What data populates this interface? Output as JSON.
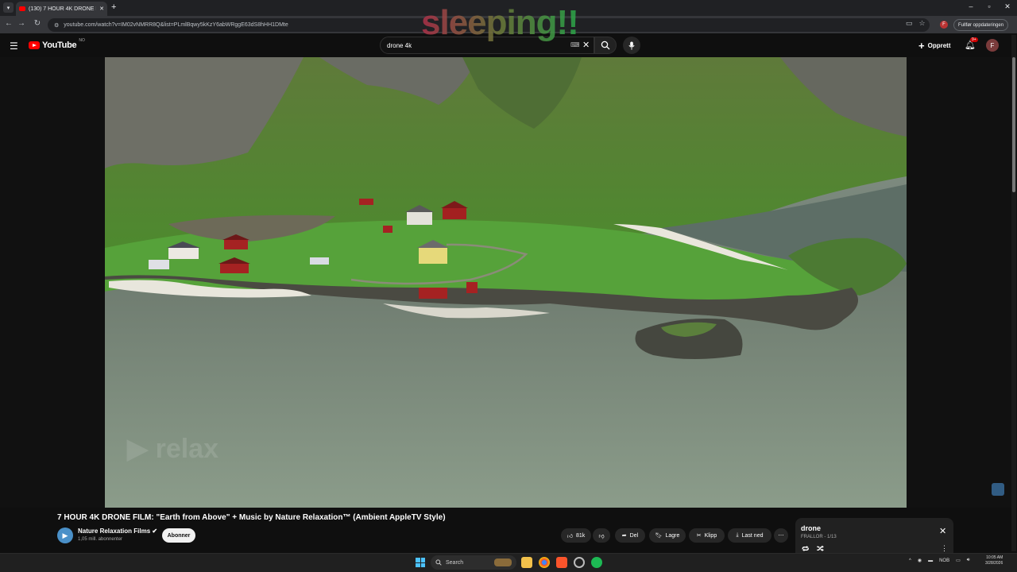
{
  "browser": {
    "tab_title": "(130) 7 HOUR 4K DRONE FILM...",
    "url": "youtube.com/watch?v=IM02vNMRR8Q&list=PLmlBqwy5kKzY6abWRggE63dS8hHH1DMte",
    "update_button": "Fullfør oppdateringen"
  },
  "overlay_text": "sleeping!!",
  "youtube": {
    "logo": "YouTube",
    "country_code": "NO",
    "search_value": "drone 4k",
    "create_label": "Opprett",
    "notification_count": "9+",
    "avatar_letter": "F"
  },
  "video": {
    "title": "7 HOUR 4K DRONE FILM: \"Earth from Above\" + Music by Nature Relaxation™ (Ambient AppleTV Style)",
    "channel": "Nature Relaxation Films ✔",
    "subscribers": "1,05 mill. abonnenter",
    "subscribe_label": "Abonner",
    "like_count": "81k",
    "share_label": "Del",
    "save_label": "Lagre",
    "clip_label": "Klipp",
    "download_label": "Last ned"
  },
  "playlist": {
    "title": "drone",
    "subtitle": "FRALLOR - 1/13"
  },
  "taskbar": {
    "search_label": "Search",
    "language": "NOB",
    "time": "10:05 AM",
    "date": "3/28/2026"
  },
  "colors": {
    "youtube_red": "#ff0000",
    "background": "#0f0f0f",
    "chip": "#272727"
  }
}
